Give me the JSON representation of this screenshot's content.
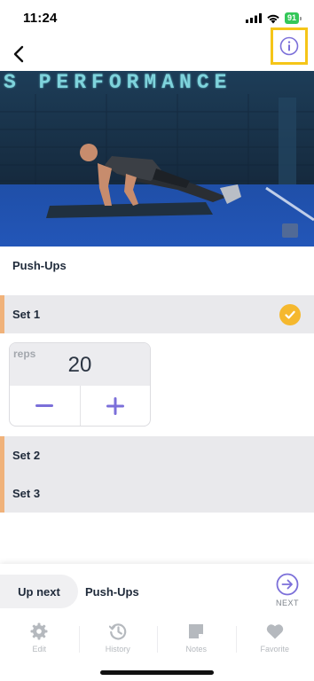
{
  "status_bar": {
    "time": "11:24",
    "battery": "91"
  },
  "hero": {
    "banner_text": "S PERFORMANCE"
  },
  "exercise": {
    "title": "Push-Ups"
  },
  "sets": [
    {
      "label": "Set 1",
      "completed": true
    },
    {
      "label": "Set 2",
      "completed": false
    },
    {
      "label": "Set 3",
      "completed": false
    }
  ],
  "reps": {
    "label": "reps",
    "value": "20"
  },
  "footer": {
    "up_next_label": "Up next",
    "up_next_exercise": "Push-Ups",
    "next_label": "NEXT",
    "tabs": [
      {
        "label": "Edit",
        "icon": "gear-icon"
      },
      {
        "label": "History",
        "icon": "history-icon"
      },
      {
        "label": "Notes",
        "icon": "notes-icon"
      },
      {
        "label": "Favorite",
        "icon": "heart-icon"
      }
    ]
  },
  "colors": {
    "accent": "#7b6fd9",
    "highlight": "#f5c518",
    "check": "#f5b82e",
    "set_marker": "#f0b27a"
  }
}
